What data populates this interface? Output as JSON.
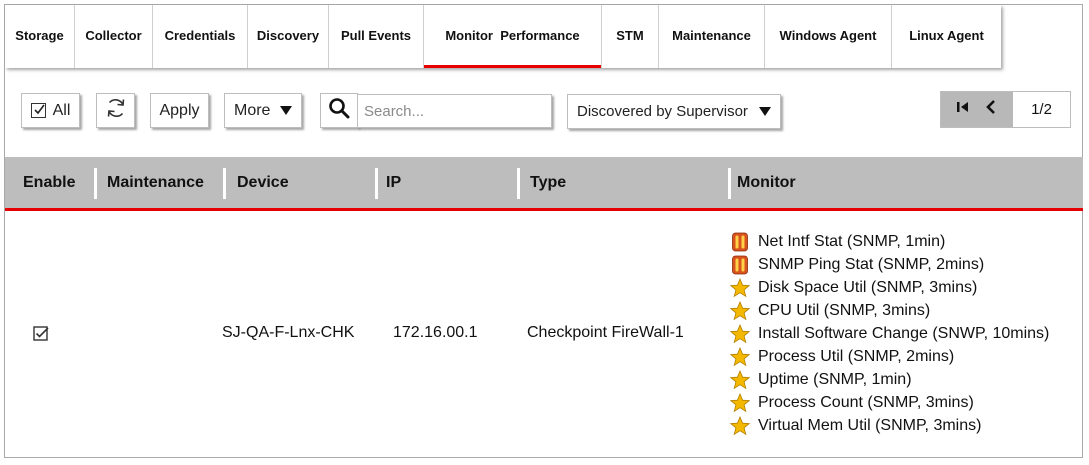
{
  "tabs": [
    {
      "label": "Storage",
      "active": false
    },
    {
      "label": "Collector",
      "active": false
    },
    {
      "label": "Credentials",
      "active": false
    },
    {
      "label": "Discovery",
      "active": false
    },
    {
      "label": "Pull Events",
      "active": false
    },
    {
      "label": "Monitor  Performance",
      "active": true
    },
    {
      "label": "STM",
      "active": false
    },
    {
      "label": "Maintenance",
      "active": false
    },
    {
      "label": "Windows Agent",
      "active": false
    },
    {
      "label": "Linux Agent",
      "active": false
    }
  ],
  "toolbar": {
    "all_label": "All",
    "apply_label": "Apply",
    "more_label": "More",
    "search_placeholder": "Search...",
    "filter_selected": "Discovered by Supervisor",
    "page_indicator": "1/2"
  },
  "table": {
    "columns": [
      "Enable",
      "Maintenance",
      "Device",
      "IP",
      "Type",
      "Monitor"
    ],
    "rows": [
      {
        "enabled": true,
        "maintenance": "",
        "device": "SJ-QA-F-Lnx-CHK",
        "ip": "172.16.00.1",
        "type": "Checkpoint FireWall-1",
        "monitors": [
          {
            "label": "Net Intf Stat (SNMP, 1min)",
            "icon": "error-status-icon"
          },
          {
            "label": "SNMP Ping Stat (SNMP, 2mins)",
            "icon": "error-status-icon"
          },
          {
            "label": "Disk Space Util (SNMP, 3mins)",
            "icon": "star-icon"
          },
          {
            "label": "CPU Util (SNMP, 3mins)",
            "icon": "star-icon"
          },
          {
            "label": "Install Software Change (SNWP, 10mins)",
            "icon": "star-icon"
          },
          {
            "label": "Process Util (SNMP, 2mins)",
            "icon": "star-icon"
          },
          {
            "label": "Uptime (SNMP, 1min)",
            "icon": "star-icon"
          },
          {
            "label": "Process Count (SNMP, 3mins)",
            "icon": "star-icon"
          },
          {
            "label": "Virtual Mem Util (SNMP, 3mins)",
            "icon": "star-icon"
          }
        ]
      }
    ]
  },
  "colors": {
    "accent_red": "#e60000",
    "header_gray": "#bdbdbd",
    "star_gold": "#f5b800",
    "error_orange": "#d9531e"
  }
}
